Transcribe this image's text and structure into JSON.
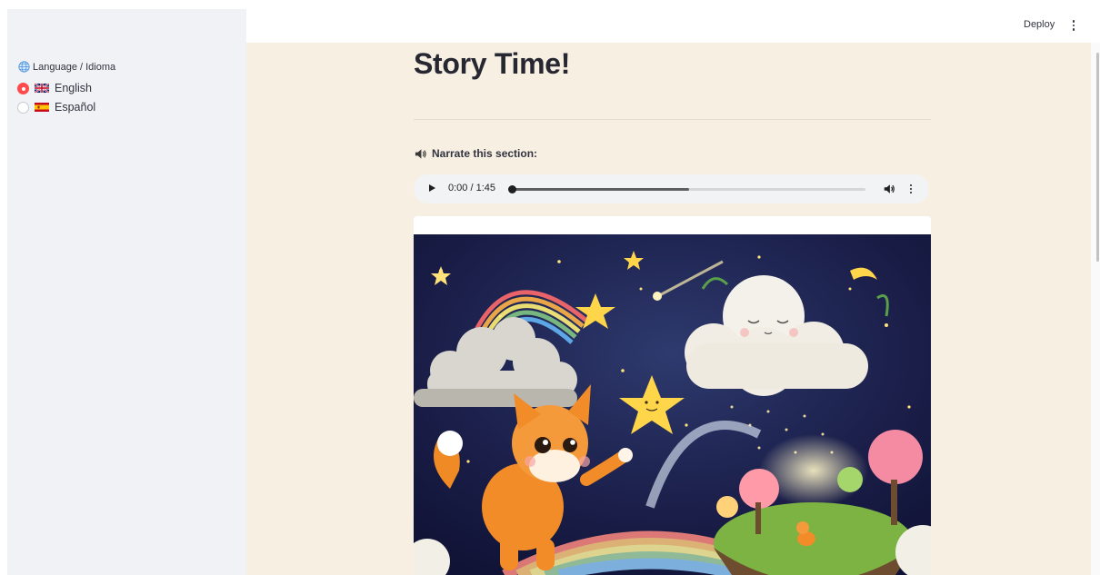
{
  "sidebar": {
    "language_label": "Language / Idioma",
    "options": [
      {
        "label": "English",
        "flag": "gb-flag",
        "selected": true
      },
      {
        "label": "Español",
        "flag": "es-flag",
        "selected": false
      }
    ]
  },
  "header": {
    "deploy_label": "Deploy"
  },
  "main": {
    "title": "Story Time!",
    "narrate_label": "Narrate this section:",
    "audio": {
      "time_display": "0:00 / 1:45",
      "buffered_fraction": 0.5
    },
    "image": {
      "description_icon": "story-illustration"
    }
  },
  "colors": {
    "accent": "#ff4b4b",
    "main_bg": "#f8efe3",
    "sidebar_bg": "#f0f2f6",
    "night_sky": "#1b1f4a"
  }
}
